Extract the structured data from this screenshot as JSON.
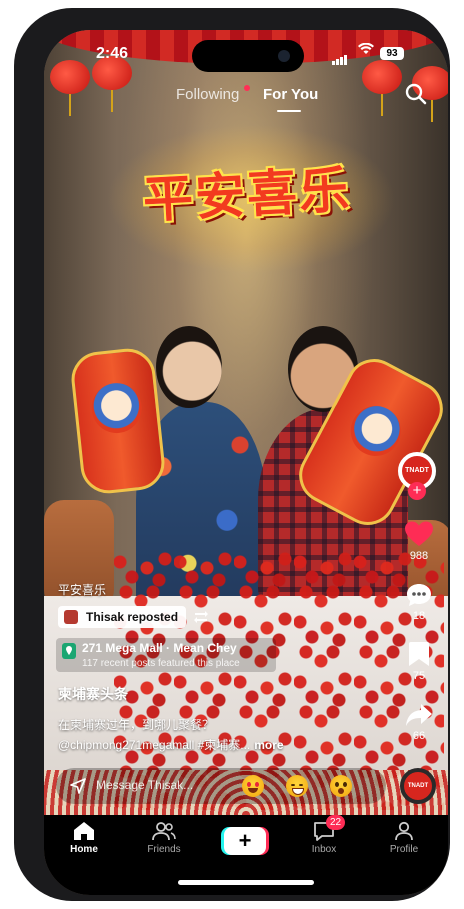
{
  "status_bar": {
    "time": "2:46",
    "battery": "93"
  },
  "feed_tabs": {
    "following": "Following",
    "for_you": "For You"
  },
  "video": {
    "overlay_title": "平安喜乐"
  },
  "right_rail": {
    "creator_avatar_text": "TNADT",
    "likes": "988",
    "comments": "18",
    "saves": "75",
    "shares": "66",
    "sound_disc_text": "TNADT"
  },
  "caption": {
    "hashtag_label": "平安喜乐",
    "repost_text": "Thisak reposted",
    "place_name": "271 Mega Mall · Mean Chey",
    "place_sub": "117 recent posts featured this place",
    "author": "柬埔寨头条",
    "line1": "在柬埔寨过年，到哪儿聚餐？",
    "line2": "@chipmong271megamall #柬埔寨...",
    "more": "more"
  },
  "message_bar": {
    "placeholder": "Message Thisak..."
  },
  "tab_bar": {
    "home": "Home",
    "friends": "Friends",
    "create": "+",
    "inbox": "Inbox",
    "inbox_badge": "22",
    "profile": "Profile"
  },
  "colors": {
    "accent": "#fe2c55",
    "cyan": "#25f4ee",
    "tabbar_bg": "#000000"
  },
  "icons": [
    "search-icon",
    "heart-icon",
    "comment-icon",
    "bookmark-icon",
    "share-icon",
    "repost-icon",
    "location-pin-icon",
    "send-icon",
    "home-icon",
    "friends-icon",
    "inbox-icon",
    "profile-icon"
  ]
}
